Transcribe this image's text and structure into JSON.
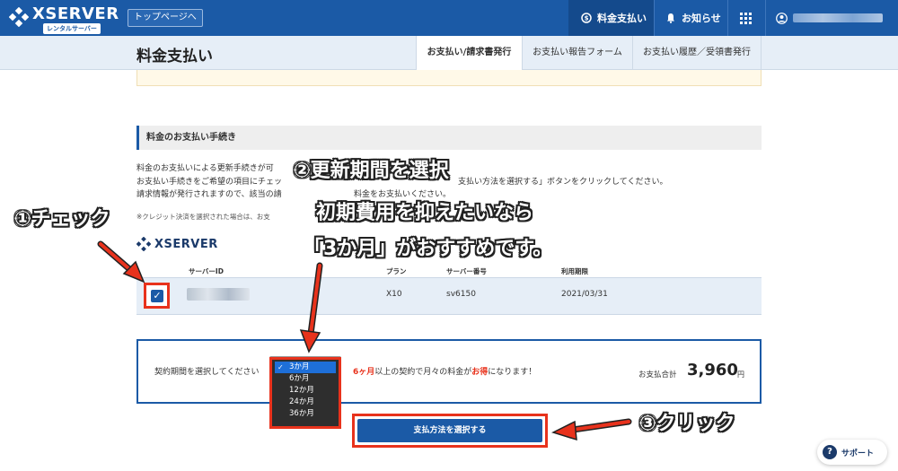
{
  "header": {
    "logo_text": "XSERVER",
    "logo_sub": "レンタルサーバー",
    "toppage_label": "トップページへ",
    "nav": [
      {
        "label": "料金支払い",
        "icon": "coin-icon",
        "active": true
      },
      {
        "label": "お知らせ",
        "icon": "bell-icon",
        "active": false
      }
    ],
    "apps_icon": "grid-icon",
    "user_icon": "user-icon"
  },
  "subheader": {
    "page_title": "料金支払い",
    "tabs": [
      "お支払い/請求書発行",
      "お支払い報告フォーム",
      "お支払い履歴／受領書発行"
    ]
  },
  "section": {
    "title": "料金のお支払い手続き",
    "desc_lines": [
      "料金のお支払いによる更新手続きが可",
      "お支払い手続きをご希望の項目にチェッ",
      "請求情報が発行されますので、該当の請",
      "※クレジット決済を選択された場合は、お支"
    ],
    "desc_right": [
      "支払い方法を選択する」ボタンをクリックしてください。",
      "料金をお支払いください。"
    ]
  },
  "table": {
    "product_logo": "XSERVER",
    "headers": {
      "server_id": "サーバーID",
      "plan": "プラン",
      "server_no": "サーバー番号",
      "expiry": "利用期限"
    },
    "row": {
      "checked": true,
      "plan": "X10",
      "server_no": "sv6150",
      "expiry": "2021/03/31"
    }
  },
  "term": {
    "label": "契約期間を選択してください",
    "options": [
      "3か月",
      "6か月",
      "12か月",
      "24か月",
      "36か月"
    ],
    "selected": "3か月",
    "promo_prefix": "6ヶ月",
    "promo_middle": "以上の契約で月々の料金が",
    "promo_red": "お得",
    "promo_suffix": "になります！",
    "total_label": "お支払合計",
    "total_value": "3,960",
    "total_unit": "円"
  },
  "pay_button": "支払方法を選択する",
  "support_label": "サポート",
  "annotations": {
    "step1": "①チェック",
    "step2_line1": "②更新期間を選択",
    "step2_line2": "初期費用を抑えたいなら",
    "step2_line3": "「3か月」がおすすめです。",
    "step3": "③クリック"
  },
  "colors": {
    "brand": "#1b5aa6",
    "highlight": "#e8321c",
    "select_blue": "#1e6fd8"
  }
}
